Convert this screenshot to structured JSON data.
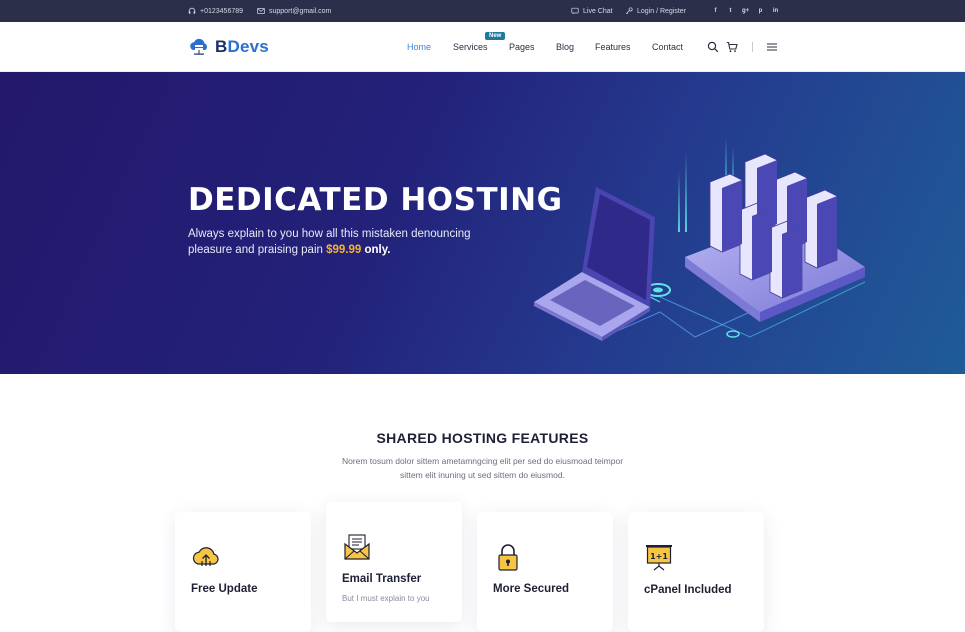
{
  "topbar": {
    "phone": "+0123456789",
    "email": "support@gmail.com",
    "live_chat": "Live Chat",
    "login_register": "Login / Register",
    "social": [
      "f",
      "t",
      "g+",
      "p",
      "in"
    ]
  },
  "header": {
    "logo_b": "B",
    "logo_devs": "Devs",
    "nav": [
      "Home",
      "Services",
      "Pages",
      "Blog",
      "Features",
      "Contact"
    ],
    "new_badge": "New"
  },
  "hero": {
    "title": "DEDICATED HOSTING",
    "text_before": "Always explain to you how all this mistaken denouncing pleasure and praising pain ",
    "price": "$99.99",
    "text_after": " only."
  },
  "features": {
    "title": "SHARED HOSTING FEATURES",
    "subtitle": "Norem tosum dolor sittem ametamngcing elit per sed do eiusmoad teimpor sittem elit inuning ut sed sittem do eiusmod.",
    "cards": [
      {
        "title": "Free Update",
        "icon": "cloud-upload-icon"
      },
      {
        "title": "Email Transfer",
        "icon": "email-icon",
        "text": "But I must explain to you"
      },
      {
        "title": "More Secured",
        "icon": "lock-icon"
      },
      {
        "title": "cPanel Included",
        "icon": "cpanel-board-icon"
      }
    ]
  },
  "colors": {
    "topbar_bg": "#2c2f4a",
    "accent": "#3f86d6",
    "hero_start": "#23186b",
    "hero_end": "#1f5c98",
    "price": "#f5b52b"
  }
}
